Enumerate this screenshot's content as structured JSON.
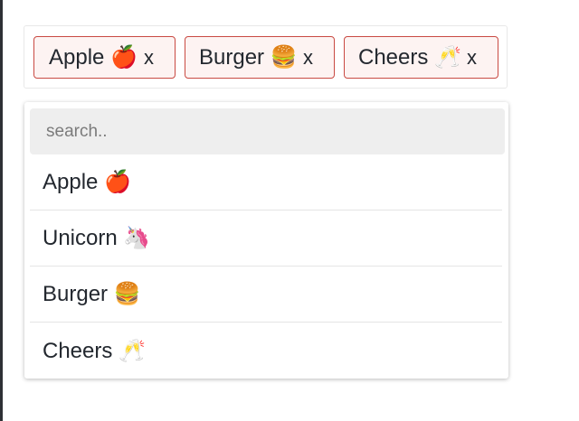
{
  "selected_tags": [
    {
      "label": "Apple 🍎",
      "remove": "x"
    },
    {
      "label": "Burger 🍔",
      "remove": "x"
    },
    {
      "label": "Cheers 🥂",
      "remove": "x"
    }
  ],
  "search": {
    "placeholder": "search..",
    "value": ""
  },
  "options": [
    {
      "label": "Apple 🍎"
    },
    {
      "label": "Unicorn 🦄"
    },
    {
      "label": "Burger 🍔"
    },
    {
      "label": "Cheers 🥂"
    }
  ],
  "colors": {
    "tag_border": "#c94a43",
    "tag_background": "#fdf3f2",
    "search_background": "#eeeeee",
    "text": "#23282f"
  }
}
